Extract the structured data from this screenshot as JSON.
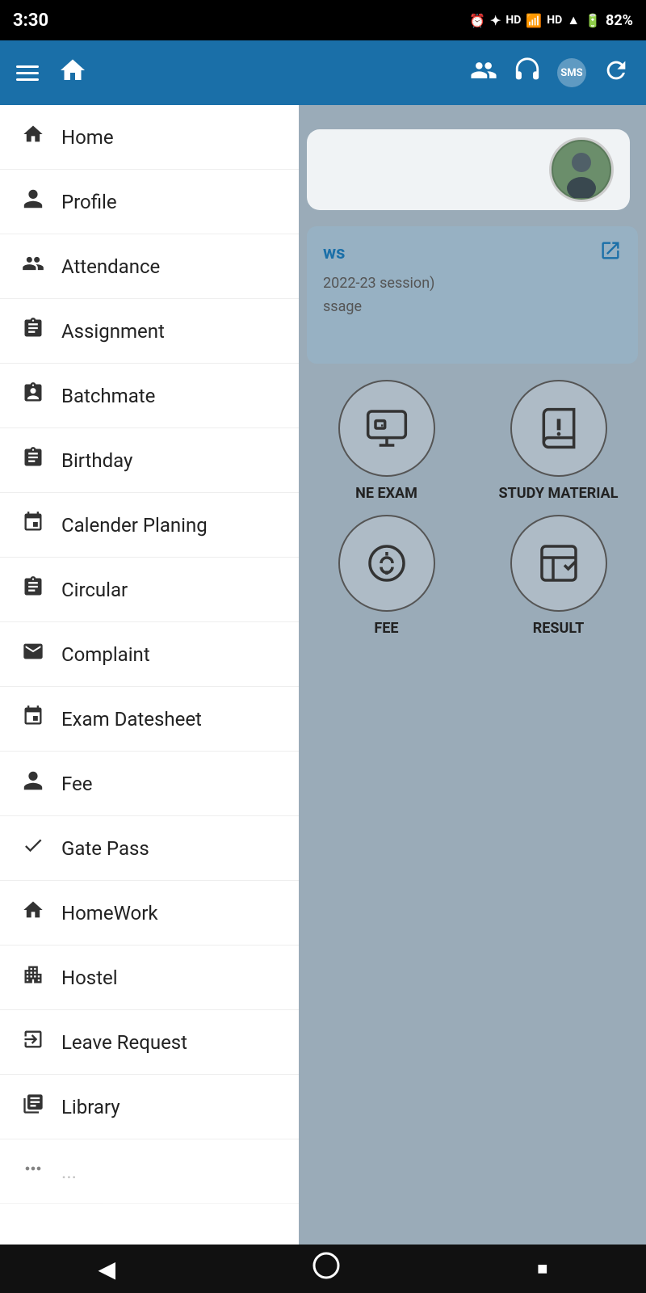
{
  "statusBar": {
    "time": "3:30",
    "batteryPercent": "82%",
    "icons": [
      "alarm",
      "bluetooth",
      "HD",
      "signal-HD",
      "signal-bars",
      "battery"
    ]
  },
  "topNav": {
    "menuIcon": "☰",
    "homeIcon": "🏠",
    "connectIcon": "👥",
    "headsetIcon": "🎧",
    "smsIcon": "SMS",
    "refreshIcon": "🔄"
  },
  "sidebar": {
    "items": [
      {
        "id": "home",
        "label": "Home",
        "icon": "🏠"
      },
      {
        "id": "profile",
        "label": "Profile",
        "icon": "👤"
      },
      {
        "id": "attendance",
        "label": "Attendance",
        "icon": "👥"
      },
      {
        "id": "assignment",
        "label": "Assignment",
        "icon": "📋"
      },
      {
        "id": "batchmate",
        "label": "Batchmate",
        "icon": "📋"
      },
      {
        "id": "birthday",
        "label": "Birthday",
        "icon": "📋"
      },
      {
        "id": "calender-planing",
        "label": "Calender Planing",
        "icon": "📅"
      },
      {
        "id": "circular",
        "label": "Circular",
        "icon": "📋"
      },
      {
        "id": "complaint",
        "label": "Complaint",
        "icon": "✉️"
      },
      {
        "id": "exam-datesheet",
        "label": "Exam Datesheet",
        "icon": "📅"
      },
      {
        "id": "fee",
        "label": "Fee",
        "icon": "👤"
      },
      {
        "id": "gate-pass",
        "label": "Gate Pass",
        "icon": "✋"
      },
      {
        "id": "homework",
        "label": "HomeWork",
        "icon": "🏠"
      },
      {
        "id": "hostel",
        "label": "Hostel",
        "icon": "🏢"
      },
      {
        "id": "leave-request",
        "label": "Leave Request",
        "icon": "↪"
      },
      {
        "id": "library",
        "label": "Library",
        "icon": "📚"
      }
    ]
  },
  "rightContent": {
    "newsTitle": "ws",
    "newsSession": "2022-23 session)",
    "newsMessage": "ssage",
    "quickItems": [
      {
        "id": "online-exam",
        "label": "NE EXAM",
        "icon": "🖥"
      },
      {
        "id": "study-material",
        "label": "STUDY MATERIAL",
        "icon": "📢"
      },
      {
        "id": "fee",
        "label": "FEE",
        "icon": "💰"
      },
      {
        "id": "result",
        "label": "RESULT",
        "icon": "📊"
      }
    ]
  },
  "bottomNav": {
    "backIcon": "◀",
    "homeIcon": "⬤",
    "squareIcon": "■"
  }
}
